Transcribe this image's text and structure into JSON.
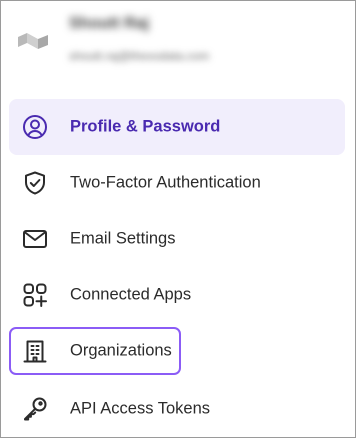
{
  "account": {
    "name": "Shoutt Raj",
    "email": "shoutt.raj@thexodata.com"
  },
  "menu": {
    "items": [
      {
        "label": "Profile & Password",
        "icon": "user-circle-icon"
      },
      {
        "label": "Two-Factor Authentication",
        "icon": "shield-check-icon"
      },
      {
        "label": "Email Settings",
        "icon": "envelope-icon"
      },
      {
        "label": "Connected Apps",
        "icon": "apps-plus-icon"
      },
      {
        "label": "Organizations",
        "icon": "building-icon"
      },
      {
        "label": "API Access Tokens",
        "icon": "key-icon"
      }
    ],
    "active_index": 0,
    "focused_index": 4
  },
  "colors": {
    "active_bg": "#f1eefc",
    "active_text": "#4a2ab0",
    "focus_ring": "#8b5cf6",
    "text": "#2b2b2b",
    "frame_border": "#9a9a9a"
  }
}
